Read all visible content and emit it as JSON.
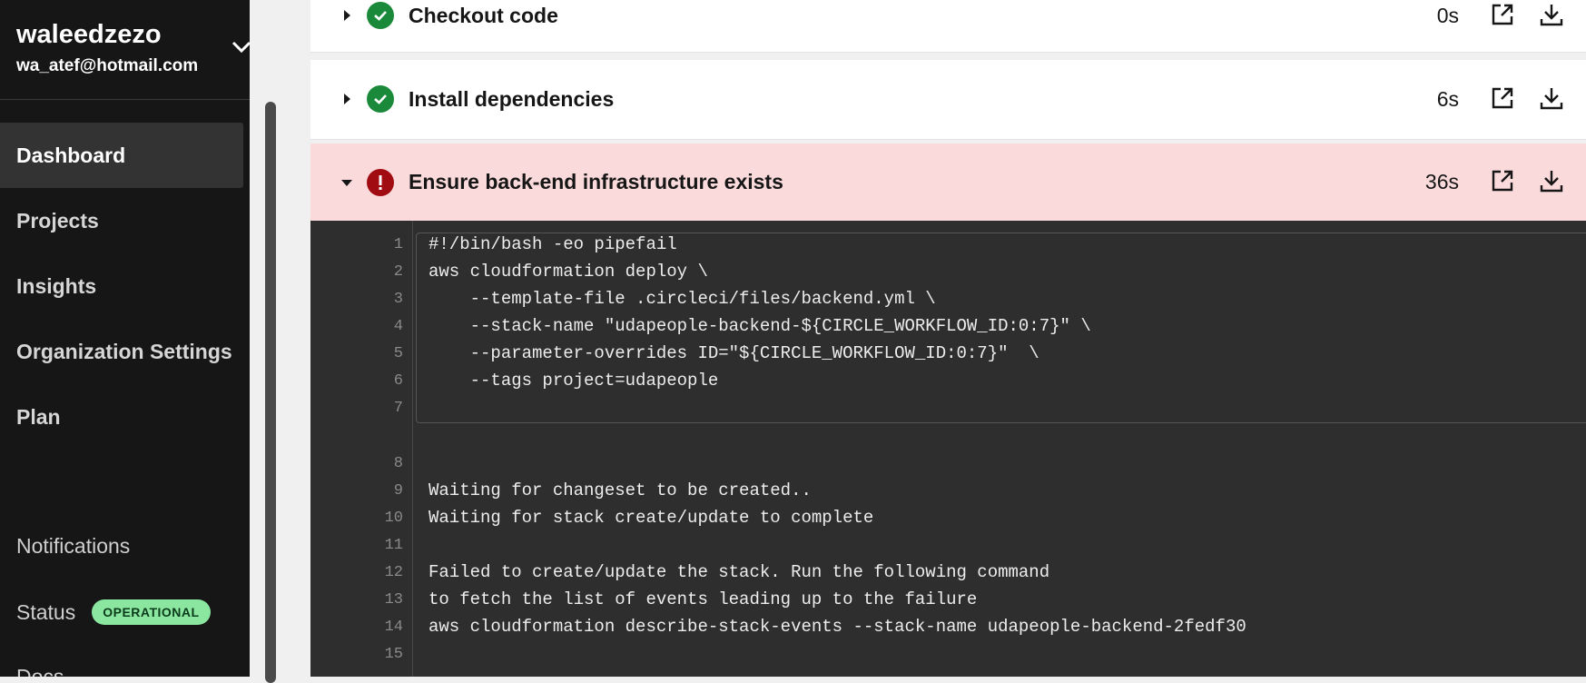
{
  "account": {
    "username": "waleedzezo",
    "email": "wa_atef@hotmail.com"
  },
  "nav": {
    "items": [
      {
        "label": "Dashboard",
        "active": true
      },
      {
        "label": "Projects"
      },
      {
        "label": "Insights"
      },
      {
        "label": "Organization Settings"
      },
      {
        "label": "Plan"
      }
    ]
  },
  "footer": {
    "notifications": "Notifications",
    "status_label": "Status",
    "status_badge": "OPERATIONAL",
    "docs": "Docs"
  },
  "steps": [
    {
      "title": "Checkout code",
      "duration": "0s",
      "status": "success",
      "expanded": false
    },
    {
      "title": "Install dependencies",
      "duration": "6s",
      "status": "success",
      "expanded": false
    },
    {
      "title": "Ensure back-end infrastructure exists",
      "duration": "36s",
      "status": "failed",
      "expanded": true
    }
  ],
  "terminal": {
    "command_lines": [
      {
        "n": "1",
        "text": "#!/bin/bash -eo pipefail"
      },
      {
        "n": "2",
        "text": "aws cloudformation deploy \\"
      },
      {
        "n": "3",
        "text": "    --template-file .circleci/files/backend.yml \\"
      },
      {
        "n": "4",
        "text": "    --stack-name \"udapeople-backend-${CIRCLE_WORKFLOW_ID:0:7}\" \\"
      },
      {
        "n": "5",
        "text": "    --parameter-overrides ID=\"${CIRCLE_WORKFLOW_ID:0:7}\"  \\"
      },
      {
        "n": "6",
        "text": "    --tags project=udapeople"
      },
      {
        "n": "7",
        "text": ""
      }
    ],
    "output_lines": [
      {
        "n": "8",
        "text": ""
      },
      {
        "n": "9",
        "text": "Waiting for changeset to be created.."
      },
      {
        "n": "10",
        "text": "Waiting for stack create/update to complete"
      },
      {
        "n": "11",
        "text": ""
      },
      {
        "n": "12",
        "text": "Failed to create/update the stack. Run the following command"
      },
      {
        "n": "13",
        "text": "to fetch the list of events leading up to the failure"
      },
      {
        "n": "14",
        "text": "aws cloudformation describe-stack-events --stack-name udapeople-backend-2fedf30"
      },
      {
        "n": "15",
        "text": ""
      }
    ]
  },
  "colors": {
    "success": "#1a8a3a",
    "failed": "#a00c12",
    "failed_row_bg": "#fbdadc",
    "status_badge_bg": "#8be7a0"
  },
  "icons": {
    "success": "check-circle-icon",
    "failed": "exclamation-circle-icon",
    "open": "external-link-icon",
    "download": "download-icon",
    "account_menu": "chevron-down-icon"
  }
}
